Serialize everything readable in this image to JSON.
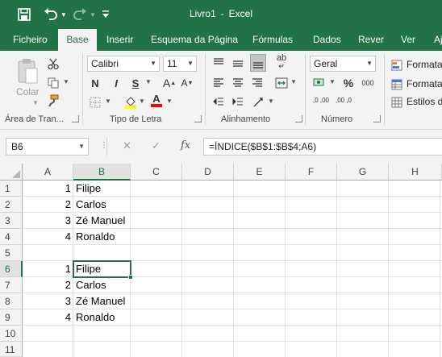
{
  "title_bar": {
    "doc_name": "Livro1",
    "separator": "-",
    "app_name": "Excel",
    "icons": [
      "save-icon",
      "undo-icon",
      "redo-icon",
      "customize-qat-icon"
    ]
  },
  "tabs": [
    {
      "label": "Ficheiro"
    },
    {
      "label": "Base"
    },
    {
      "label": "Inserir"
    },
    {
      "label": "Esquema da Página"
    },
    {
      "label": "Fórmulas"
    },
    {
      "label": "Dados"
    },
    {
      "label": "Rever"
    },
    {
      "label": "Ver"
    },
    {
      "label": "Aj"
    }
  ],
  "active_tab": "Base",
  "ribbon": {
    "clipboard": {
      "paste_label": "Colar",
      "group_label": "Área de Tran..."
    },
    "font": {
      "font_name": "Calibri",
      "font_size": "11",
      "bold": "N",
      "italic": "I",
      "underline": "S",
      "grow": "A",
      "shrink": "A",
      "font_color_letter": "A",
      "group_label": "Tipo de Letra"
    },
    "alignment": {
      "wrap_glyph": "ab",
      "group_label": "Alinhamento"
    },
    "number": {
      "format": "Geral",
      "percent": "%",
      "comma": "000",
      "inc_decimal": ",0 ,00",
      "dec_decimal": ",00 ,0",
      "group_label": "Número"
    },
    "styles": {
      "items": [
        "Formata",
        "Formata",
        "Estilos d"
      ]
    }
  },
  "formula_bar": {
    "name_box": "B6",
    "cancel": "✕",
    "enter": "✓",
    "fx": "fx",
    "formula": "=ÍNDICE($B$1:$B$4;A6)"
  },
  "columns": [
    "A",
    "B",
    "C",
    "D",
    "E",
    "F",
    "G",
    "H"
  ],
  "rows": [
    "1",
    "2",
    "3",
    "4",
    "5",
    "6",
    "7",
    "8",
    "9",
    "10",
    "11"
  ],
  "cells": {
    "A1": "1",
    "B1": "Filipe",
    "A2": "2",
    "B2": "Carlos",
    "A3": "3",
    "B3": "Zé Manuel",
    "A4": "4",
    "B4": "Ronaldo",
    "A6": "1",
    "B6": "Filipe",
    "A7": "2",
    "B7": "Carlos",
    "A8": "3",
    "B8": "Zé Manuel",
    "A9": "4",
    "B9": "Ronaldo"
  },
  "selected_cell": "B6",
  "colors": {
    "accent": "#217346",
    "ribbon_bg": "#f3f3f3",
    "font_highlight": "#ffff00",
    "font_color": "#ff0000"
  }
}
